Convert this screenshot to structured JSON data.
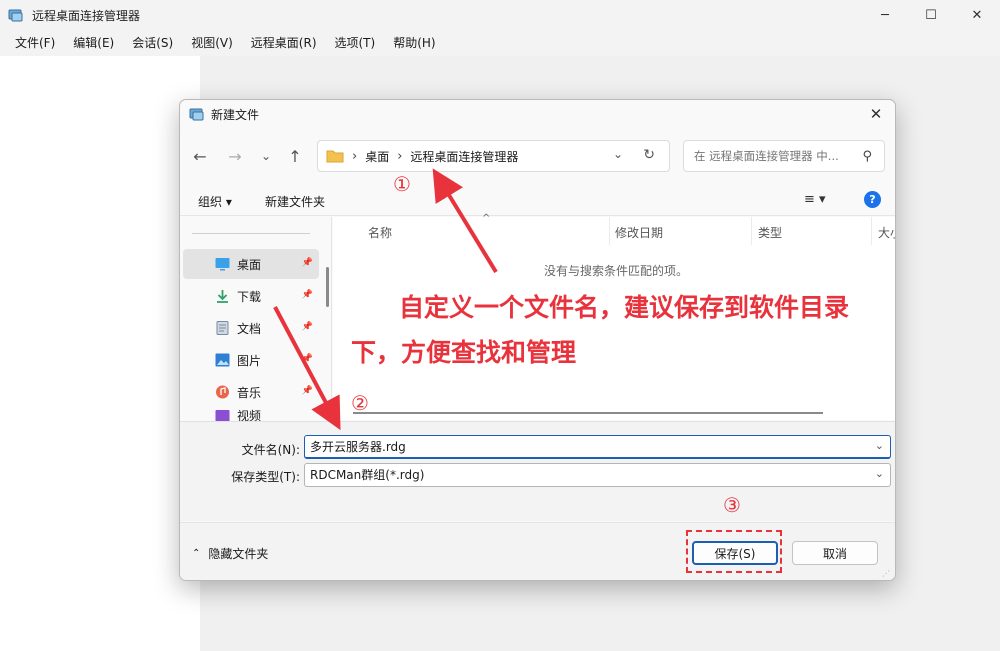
{
  "app": {
    "title": "远程桌面连接管理器",
    "menu": [
      "文件(F)",
      "编辑(E)",
      "会话(S)",
      "视图(V)",
      "远程桌面(R)",
      "选项(T)",
      "帮助(H)"
    ]
  },
  "dialog": {
    "title": "新建文件",
    "breadcrumb": [
      "桌面",
      "远程桌面连接管理器"
    ],
    "search_placeholder": "在 远程桌面连接管理器 中...",
    "commands": {
      "organize": "组织 ▾",
      "new_folder": "新建文件夹"
    },
    "nav_items": [
      {
        "label": "桌面",
        "icon": "desktop-icon",
        "selected": true
      },
      {
        "label": "下载",
        "icon": "download-icon"
      },
      {
        "label": "文档",
        "icon": "documents-icon"
      },
      {
        "label": "图片",
        "icon": "pictures-icon"
      },
      {
        "label": "音乐",
        "icon": "music-icon"
      },
      {
        "label": "视频",
        "icon": "videos-icon"
      }
    ],
    "columns": [
      "名称",
      "修改日期",
      "类型",
      "大小"
    ],
    "empty_message": "没有与搜索条件匹配的项。",
    "filename_label": "文件名(N):",
    "filename_value": "多开云服务器.rdg",
    "filetype_label": "保存类型(T):",
    "filetype_value": "RDCMan群组(*.rdg)",
    "hide_folders": "隐藏文件夹",
    "save_button": "保存(S)",
    "cancel_button": "取消"
  },
  "annotations": {
    "step1": "①",
    "step2": "②",
    "step3": "③",
    "instruction": "自定义一个文件名，建议保存到软件目录下，方便查找和管理",
    "color": "#e8323c"
  }
}
